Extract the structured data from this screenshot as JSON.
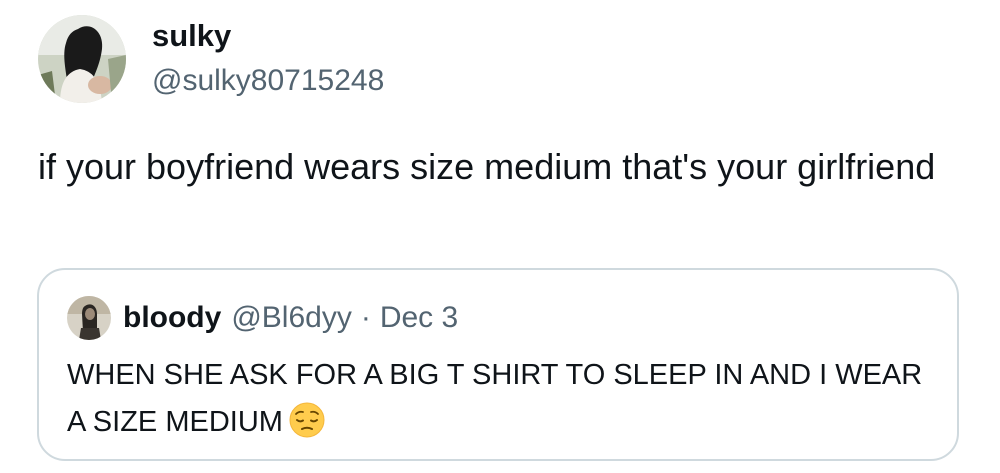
{
  "tweet": {
    "author": {
      "display_name": "sulky",
      "handle": "@sulky80715248",
      "avatar_icon": "profile-photo"
    },
    "text": "if your boyfriend wears size medium that's your girlfriend"
  },
  "quoted_tweet": {
    "author": {
      "display_name": "bloody",
      "handle": "@Bl6dyy",
      "avatar_icon": "profile-photo"
    },
    "separator": "·",
    "date": "Dec 3",
    "text": "WHEN SHE ASK FOR A BIG T SHIRT TO SLEEP IN AND I WEAR A SIZE MEDIUM",
    "emoji": "pensive-face-emoji"
  },
  "colors": {
    "primary_text": "#0f1419",
    "secondary_text": "#536471",
    "border": "#cfd9de",
    "background": "#ffffff"
  }
}
